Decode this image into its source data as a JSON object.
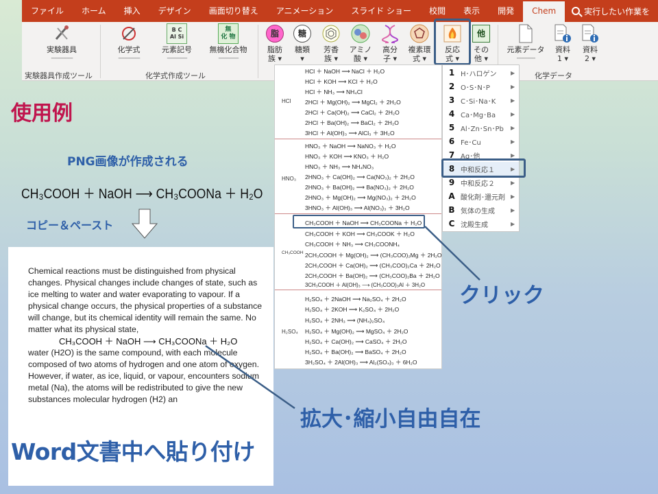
{
  "tabs": [
    "ファイル",
    "ホーム",
    "挿入",
    "デザイン",
    "画面切り替え",
    "アニメーション",
    "スライド ショー",
    "校閲",
    "表示",
    "開発",
    "Chem"
  ],
  "tell_me": "実行したい作業を",
  "ribbon": {
    "lab_equipment": "実験器具",
    "lab_group": "実験器具作成ツール",
    "formula": "化学式",
    "element_symbol": "元素記号",
    "inorganic": "無機化合物",
    "formula_group": "化学式作成ツール",
    "fatty": "脂肪族",
    "fatty_l1": "脂肪",
    "fatty_l2": "族 ▾",
    "sugar_l1": "糖類",
    "sugar_l2": "▾",
    "aromatic_l1": "芳香",
    "aromatic_l2": "族 ▾",
    "amino_l1": "アミノ",
    "amino_l2": "酸 ▾",
    "polymer_l1": "高分",
    "polymer_l2": "子 ▾",
    "hetero_l1": "複素環",
    "hetero_l2": "式 ▾",
    "reaction_l1": "反応",
    "reaction_l2": "式 ▾",
    "other_l1": "その",
    "other_l2": "他 ▾",
    "element_data": "元素データ",
    "doc1_l1": "資料",
    "doc1_l2": "1 ▾",
    "doc2_l1": "資料",
    "doc2_l2": "2 ▾",
    "chem_data_group": "化学データ",
    "icon_fat": "脂",
    "icon_sugar": "糖",
    "icon_other": "他",
    "icon_elem_top": "B  C",
    "icon_elem_bot": "Al  Si",
    "icon_inorg_top": "無",
    "icon_inorg_bot": "化 物"
  },
  "left": {
    "usage_title": "使用例",
    "png_note": "PNG画像が作成される",
    "equation": "CH₃COOH ＋ NaOH ⟶ CH₃COONa ＋ H₂O",
    "copy_note": "コピー＆ペースト",
    "word_note": "Word文書中へ貼り付け"
  },
  "doc": {
    "para1": "Chemical reactions must be distinguished from physical changes. Physical changes include changes of state, such as ice melting to water and water evaporating to vapour. If a physical change occurs, the physical properties of a substance will change, but its chemical identity will remain the same. No matter what its physical state,",
    "equation": "CH₃COOH ＋ NaOH ⟶ CH₃COONa ＋ H₂O",
    "para2": "water (H2O) is the same compound, with each molecule composed of two atoms of hydrogen and one atom of oxygen. However, if water, as ice, liquid, or vapour, encounters sodium metal (Na), the atoms will be redistributed to give the new substances molecular hydrogen (H2) an"
  },
  "panel": {
    "hcl_label": "HCl",
    "hcl": [
      "HCl ＋ NaOH ⟶ NaCl ＋ H₂O",
      "HCl ＋ KOH ⟶ KCl ＋ H₂O",
      "HCl ＋ NH₃ ⟶ NH₄Cl",
      "2HCl ＋ Mg(OH)₂ ⟶ MgCl₂ ＋ 2H₂O",
      "2HCl ＋ Ca(OH)₂ ⟶ CaCl₂ ＋ 2H₂O",
      "2HCl ＋ Ba(OH)₂ ⟶ BaCl₂ ＋ 2H₂O",
      "3HCl ＋ Al(OH)₃ ⟶ AlCl₃ ＋ 3H₂O"
    ],
    "hno3_label": "HNO₃",
    "hno3": [
      "HNO₃ ＋ NaOH ⟶ NaNO₃ ＋ H₂O",
      "HNO₃ ＋ KOH ⟶ KNO₃ ＋ H₂O",
      "HNO₃ ＋ NH₃ ⟶ NH₄NO₃",
      "2HNO₃ ＋ Ca(OH)₂ ⟶ Ca(NO₃)₂ ＋ 2H₂O",
      "2HNO₃ ＋ Ba(OH)₂ ⟶ Ba(NO₃)₂ ＋ 2H₂O",
      "2HNO₃ ＋ Mg(OH)₂ ⟶ Mg(NO₃)₂ ＋ 2H₂O",
      "3HNO₃ ＋ Al(OH)₃ ⟶ Al(NO₃)₃ ＋ 3H₂O"
    ],
    "ch3cooh_label": "CH₃COOH",
    "ch3cooh": [
      "CH₃COOH ＋ NaOH ⟶ CH₃COONa ＋ H₂O",
      "CH₃COOH ＋ KOH ⟶ CH₃COOK ＋ H₂O",
      "CH₃COOH ＋ NH₃ ⟶ CH₃COONH₄",
      "2CH₃COOH ＋ Mg(OH)₂ ⟶ (CH₃COO)₂Mg ＋ 2H₂O",
      "2CH₃COOH ＋ Ca(OH)₂ ⟶ (CH₃COO)₂Ca ＋ 2H₂O",
      "2CH₃COOH ＋ Ba(OH)₂ ⟶ (CH₃COO)₂Ba ＋ 2H₂O",
      "3CH₃COOH ＋ Al(OH)₃ ⟶ (CH₃COO)₃Al ＋ 3H₂O"
    ],
    "h2so4_label": "H₂SO₄",
    "h2so4": [
      "H₂SO₄ ＋ 2NaOH ⟶ Na₂SO₄ ＋ 2H₂O",
      "H₂SO₄ ＋ 2KOH ⟶ K₂SO₄ ＋ 2H₂O",
      "H₂SO₄ ＋ 2NH₃ ⟶ (NH₄)₂SO₄",
      "H₂SO₄ ＋ Mg(OH)₂ ⟶ MgSO₄ ＋ 2H₂O",
      "H₂SO₄ ＋ Ca(OH)₂ ⟶ CaSO₄ ＋ 2H₂O",
      "H₂SO₄ ＋ Ba(OH)₂ ⟶ BaSO₄ ＋ 2H₂O",
      "3H₂SO₄ ＋ 2Al(OH)₃ ⟶ Al₂(SO₄)₃ ＋ 6H₂O"
    ]
  },
  "submenu": [
    {
      "key": "1",
      "label": "H･ハロゲン"
    },
    {
      "key": "2",
      "label": "O･S･N･P"
    },
    {
      "key": "3",
      "label": "C･Si･Na･K"
    },
    {
      "key": "4",
      "label": "Ca･Mg･Ba"
    },
    {
      "key": "5",
      "label": "Al･Zn･Sn･Pb"
    },
    {
      "key": "6",
      "label": "Fe･Cu"
    },
    {
      "key": "7",
      "label": "Ag･他"
    },
    {
      "key": "8",
      "label": "中和反応１"
    },
    {
      "key": "9",
      "label": "中和反応２"
    },
    {
      "key": "A",
      "label": "酸化剤･還元剤"
    },
    {
      "key": "B",
      "label": "気体の生成"
    },
    {
      "key": "C",
      "label": "沈殿生成"
    }
  ],
  "annotations": {
    "click": "クリック",
    "zoom": "拡大･縮小自由自在"
  },
  "colors": {
    "ribbon_red": "#c43e1c",
    "highlight": "#3b5e87",
    "title_pink": "#c0144d",
    "note_blue": "#2e5fa8"
  }
}
